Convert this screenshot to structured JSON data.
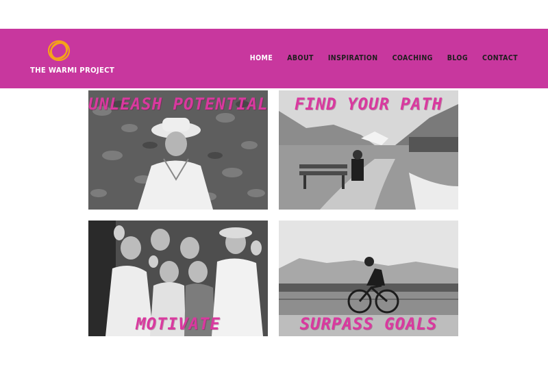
{
  "site": {
    "name": "THE WARMI PROJECT"
  },
  "nav": {
    "items": [
      {
        "label": "HOME"
      },
      {
        "label": "ABOUT"
      },
      {
        "label": "INSPIRATION"
      },
      {
        "label": "COACHING"
      },
      {
        "label": "BLOG"
      },
      {
        "label": "CONTACT"
      }
    ]
  },
  "tiles": [
    {
      "title": "UNLEASH POTENTIAL"
    },
    {
      "title": "FIND YOUR PATH"
    },
    {
      "title": "MOTIVATE"
    },
    {
      "title": "SURPASS GOALS"
    }
  ],
  "colors": {
    "brand": "#c8379e",
    "title": "#d9399f",
    "nav_active": "#ffffff",
    "nav": "#1e1e1e"
  }
}
